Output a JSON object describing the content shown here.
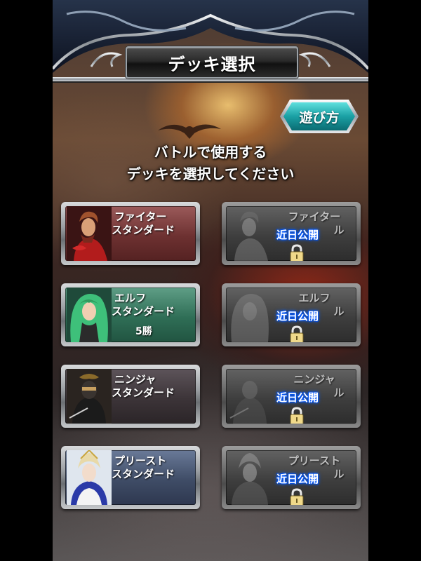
{
  "header": {
    "title": "デッキ選択"
  },
  "howto": {
    "label": "遊び方"
  },
  "instruction": {
    "line1": "バトルで使用する",
    "line2": "デッキを選択してください"
  },
  "decks": [
    {
      "id": "fighter-standard",
      "name_line1": "ファイター",
      "name_line2": "スタンダード",
      "wins": "",
      "locked": false
    },
    {
      "id": "fighter-locked",
      "name_line1": "ファイター",
      "name_line2": "ル",
      "badge": "近日公開",
      "locked": true
    },
    {
      "id": "elf-standard",
      "name_line1": "エルフ",
      "name_line2": "スタンダード",
      "wins": "5勝",
      "locked": false
    },
    {
      "id": "elf-locked",
      "name_line1": "エルフ",
      "name_line2": "ル",
      "badge": "近日公開",
      "locked": true
    },
    {
      "id": "ninja-standard",
      "name_line1": "ニンジャ",
      "name_line2": "スタンダード",
      "wins": "",
      "locked": false
    },
    {
      "id": "ninja-locked",
      "name_line1": "ニンジャ",
      "name_line2": "ル",
      "badge": "近日公開",
      "locked": true
    },
    {
      "id": "priest-standard",
      "name_line1": "プリースト",
      "name_line2": "スタンダード",
      "wins": "",
      "locked": false
    },
    {
      "id": "priest-locked",
      "name_line1": "プリースト",
      "name_line2": "ル",
      "badge": "近日公開",
      "locked": true
    }
  ],
  "colors": {
    "howto_teal": "#1aa0a4",
    "coming_soon_glow": "#0a5cff"
  }
}
